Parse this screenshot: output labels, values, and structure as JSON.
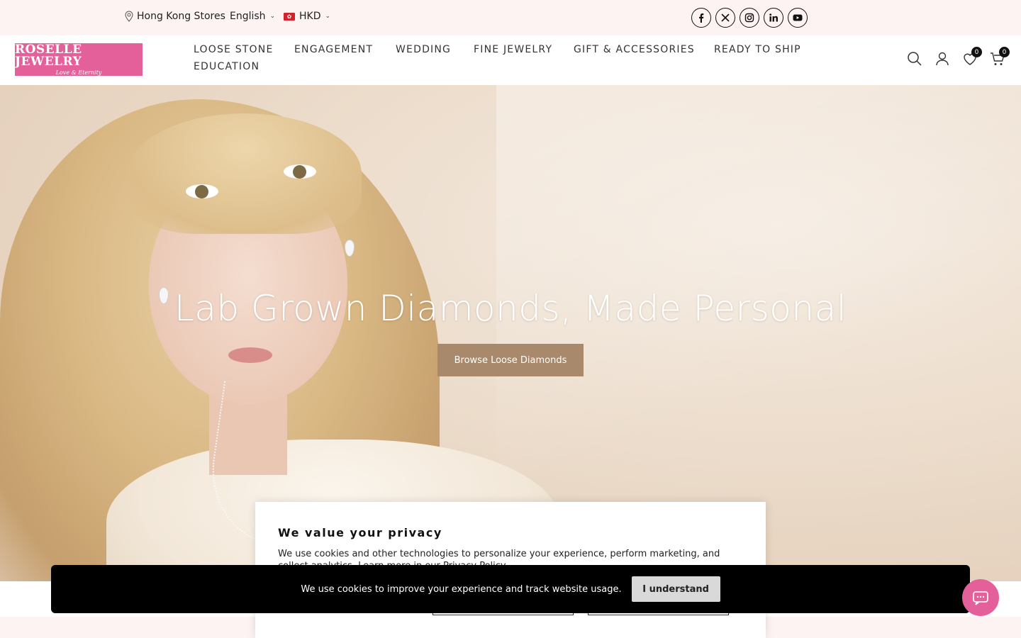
{
  "topbar": {
    "store_label": "Hong Kong Stores",
    "language": "English",
    "currency": "HKD",
    "socials": [
      "facebook-icon",
      "x-icon",
      "instagram-icon",
      "linkedin-icon",
      "youtube-icon"
    ]
  },
  "header": {
    "logo_text": "ROSELLE JEWELRY",
    "logo_tagline": "Love & Eternity",
    "nav": [
      "LOOSE STONE",
      "ENGAGEMENT",
      "WEDDING",
      "FINE JEWELRY",
      "GIFT & ACCESSORIES",
      "READY TO SHIP",
      "EDUCATION"
    ],
    "wishlist_count": "0",
    "cart_count": "0"
  },
  "hero": {
    "title": "Lab Grown Diamonds, Made Personal",
    "button_label": "Browse Loose Diamonds"
  },
  "privacy": {
    "title": "We value your privacy",
    "text": "We use cookies and other technologies to personalize your experience, perform marketing, and collect analytics. Learn more in our Privacy Policy."
  },
  "cookie_bar": {
    "text": "We use cookies to improve your experience and track website usage.",
    "button_label": "I understand"
  },
  "colors": {
    "brand_pink": "#e4609a",
    "hero_button": "#a8896c",
    "topbar_bg": "#fdf3f3"
  }
}
